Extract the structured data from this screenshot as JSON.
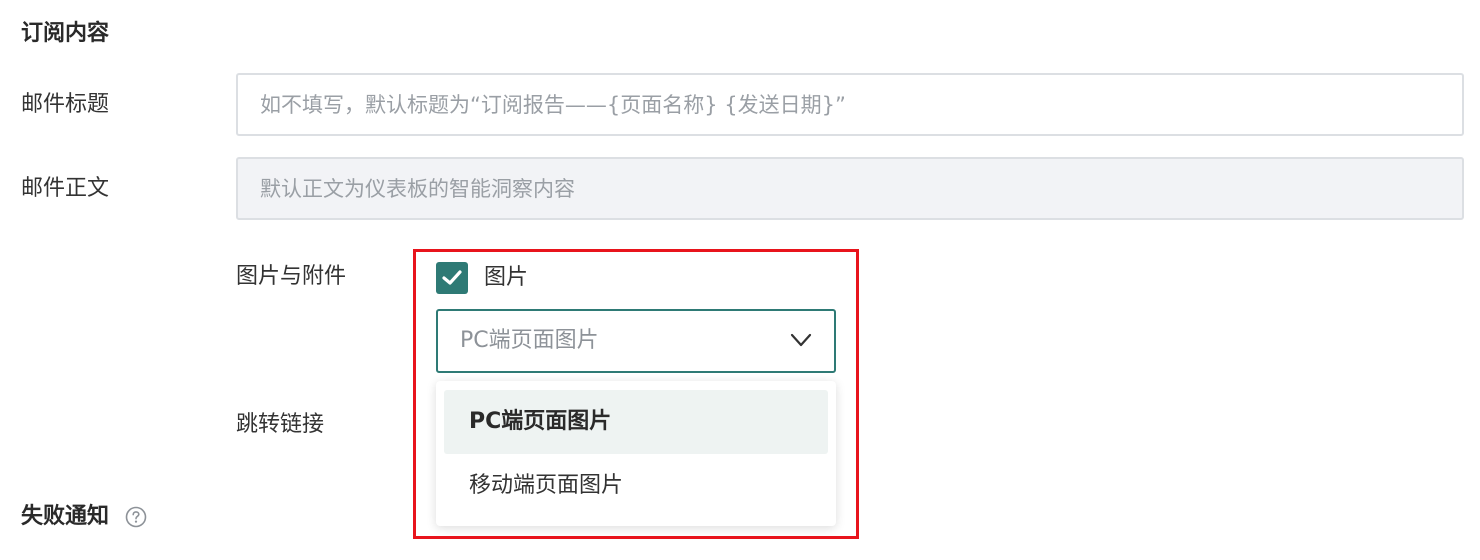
{
  "subscription_content": {
    "title": "订阅内容",
    "email_subject": {
      "label": "邮件标题",
      "value": "",
      "placeholder": "如不填写，默认标题为“订阅报告——{页面名称} {发送日期}”"
    },
    "email_body": {
      "label": "邮件正文",
      "value": "",
      "placeholder": "默认正文为仪表板的智能洞察内容"
    },
    "images_attachments": {
      "label": "图片与附件",
      "checkbox_label": "图片",
      "checked": true,
      "select_value": "PC端页面图片",
      "options": [
        {
          "label": "PC端页面图片",
          "selected": true
        },
        {
          "label": "移动端页面图片",
          "selected": false
        }
      ]
    },
    "redirect_link": {
      "label": "跳转链接"
    }
  },
  "failure_notification": {
    "title": "失败通知",
    "help_icon": "question-circle-icon"
  },
  "colors": {
    "accent": "#2e7a75",
    "highlight_border": "#e8141c",
    "option_selected_bg": "#eef3f2",
    "disabled_bg": "#f2f3f6"
  }
}
